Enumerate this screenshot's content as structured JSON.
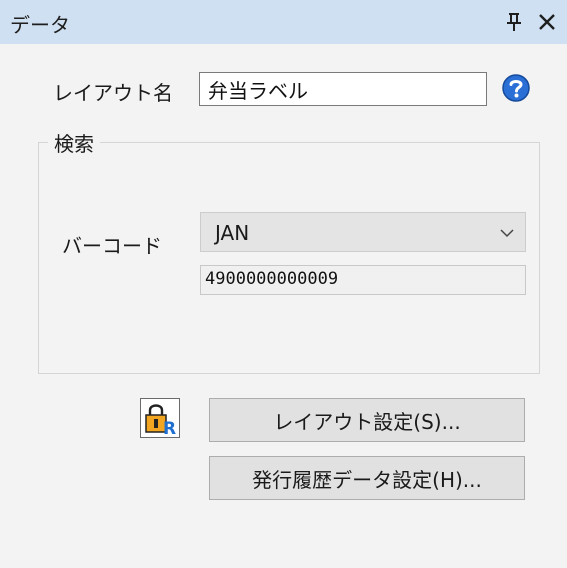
{
  "panel": {
    "title": "データ"
  },
  "layout_name": {
    "label": "レイアウト名",
    "value": "弁当ラベル"
  },
  "search": {
    "legend": "検索",
    "barcode": {
      "label": "バーコード",
      "type_selected": "JAN",
      "value": "4900000000009"
    }
  },
  "buttons": {
    "layout_settings": "レイアウト設定(S)...",
    "history_settings": "発行履歴データ設定(H)..."
  },
  "icons": {
    "pin": "pin-icon",
    "close": "close-icon",
    "help": "help-icon",
    "lock": "lock-icon",
    "dropdown": "chevron-down-icon"
  },
  "colors": {
    "titlebar": "#cfe0f2",
    "background": "#f3f3f3",
    "help_blue": "#2a6fd6",
    "button": "#e1e1e1"
  }
}
